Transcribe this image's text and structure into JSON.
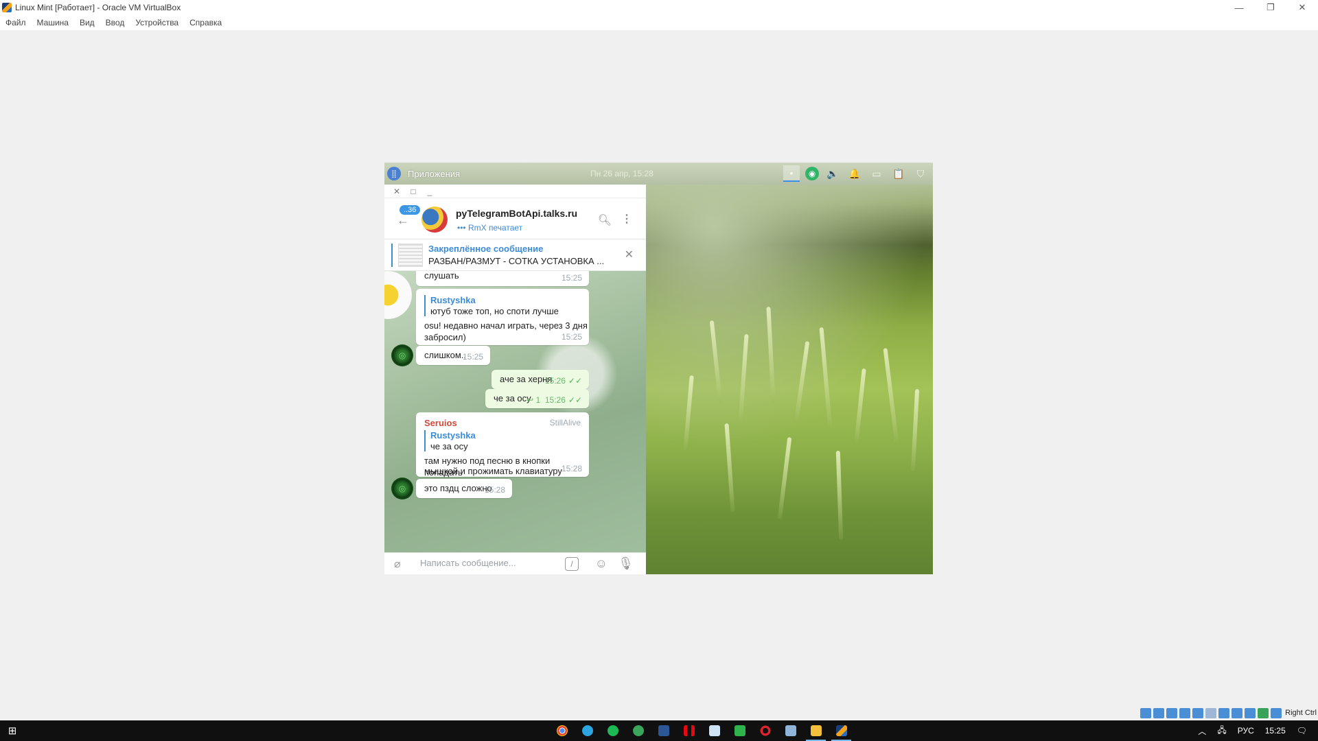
{
  "vbox": {
    "title": "Linux Mint [Работает] - Oracle VM VirtualBox",
    "window_controls": {
      "minimize": "—",
      "restore": "❐",
      "close": "✕"
    },
    "menu": [
      "Файл",
      "Машина",
      "Вид",
      "Ввод",
      "Устройства",
      "Справка"
    ],
    "host_key": "Right Ctrl"
  },
  "mint_panel": {
    "apps_label": "Приложения",
    "clock": "Пн 26 апр, 15:28"
  },
  "telegram": {
    "wm_buttons": {
      "close": "✕",
      "maximize": "□",
      "minimize": "_"
    },
    "unread_badge": "..36",
    "chat_title": "pyTelegramBotApi.talks.ru",
    "chat_status": "••• RmX печатает",
    "pinned": {
      "title": "Закреплённое сообщение",
      "text": "РАЗБАН/РАЗМУТ - СОТКА  УСТАНОВКА ..."
    },
    "messages": {
      "m1": {
        "text": "слушать",
        "time": "15:25"
      },
      "m2": {
        "reply_name": "Rustyshka",
        "reply_text": "ютуб тоже топ, но споти лучше",
        "text_line1": "osu! недавно начал играть, через 3 дня",
        "text_line2": "забросил)",
        "time": "15:25"
      },
      "m3": {
        "text": "слишком..",
        "time": "15:25"
      },
      "m4": {
        "text": "аче за херня",
        "time": "15:26",
        "checks": "✓✓"
      },
      "m5": {
        "text": "че за осу",
        "reply_count": "↩ 1",
        "time": "15:26",
        "checks": "✓✓"
      },
      "m6": {
        "sender": "Seruios",
        "tag": "StillAlive",
        "reply_name": "Rustyshka",
        "reply_text": "че за осу",
        "text_line1": "там нужно под песню в кнопки попадать",
        "text_line2": "мышкой и прожимать клавиатуру",
        "time": "15:28"
      },
      "m7": {
        "text": "это пздц сложно",
        "time": "15:28"
      }
    },
    "composer": {
      "placeholder": "Написать сообщение..."
    }
  },
  "taskbar": {
    "language": "РУС",
    "time": "15:25"
  }
}
